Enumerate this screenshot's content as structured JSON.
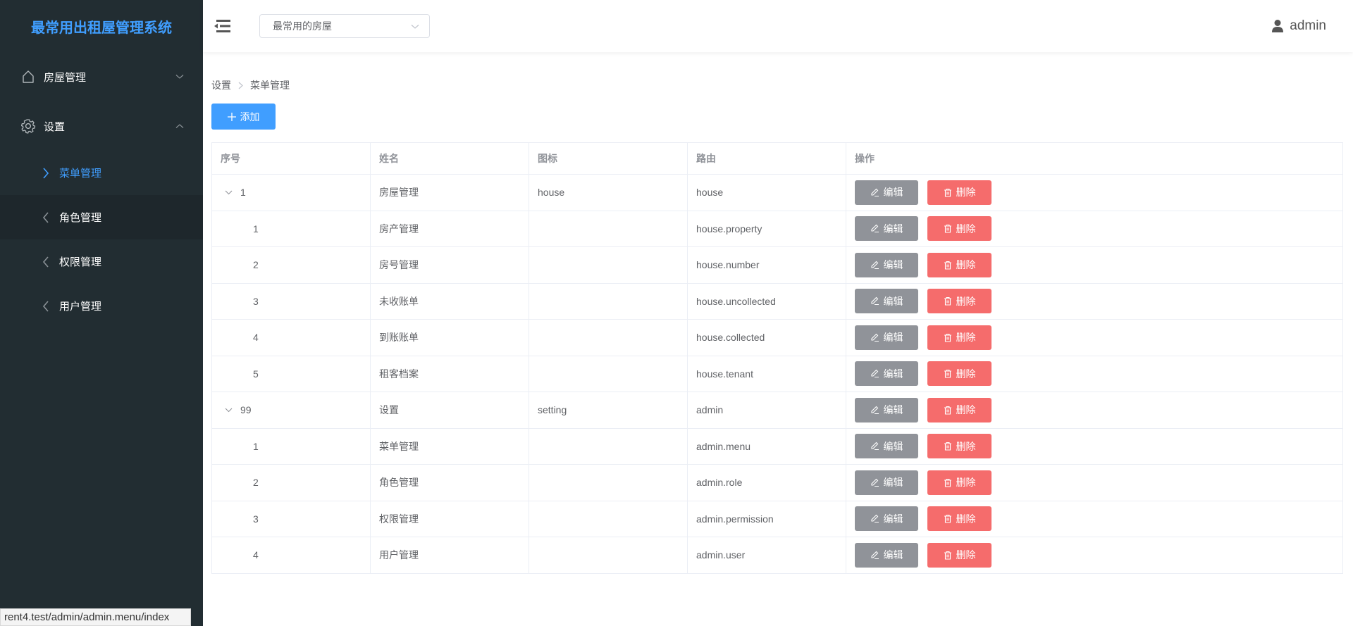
{
  "app": {
    "title": "最常用出租屋管理系统"
  },
  "sidebar": {
    "groups": [
      {
        "label": "房屋管理",
        "icon": "house-icon",
        "expanded": false
      },
      {
        "label": "设置",
        "icon": "gear-icon",
        "expanded": true
      }
    ],
    "sub_items": [
      {
        "label": "菜单管理",
        "active": true
      },
      {
        "label": "角色管理",
        "active": false
      },
      {
        "label": "权限管理",
        "active": false
      },
      {
        "label": "用户管理",
        "active": false
      }
    ]
  },
  "status_bar": {
    "url": "rent4.test/admin/admin.menu/index"
  },
  "topbar": {
    "house_select": {
      "value": "最常用的房屋"
    },
    "user": {
      "name": "admin"
    }
  },
  "breadcrumb": {
    "items": [
      "设置",
      "菜单管理"
    ]
  },
  "toolbar": {
    "add_label": "添加"
  },
  "table": {
    "columns": [
      "序号",
      "姓名",
      "图标",
      "路由",
      "操作"
    ],
    "edit_label": "编辑",
    "delete_label": "删除",
    "rows": [
      {
        "index": "1",
        "name": "房屋管理",
        "icon": "house",
        "route": "house",
        "parent": true
      },
      {
        "index": "1",
        "name": "房产管理",
        "icon": "",
        "route": "house.property",
        "parent": false
      },
      {
        "index": "2",
        "name": "房号管理",
        "icon": "",
        "route": "house.number",
        "parent": false
      },
      {
        "index": "3",
        "name": "未收账单",
        "icon": "",
        "route": "house.uncollected",
        "parent": false
      },
      {
        "index": "4",
        "name": "到账账单",
        "icon": "",
        "route": "house.collected",
        "parent": false
      },
      {
        "index": "5",
        "name": "租客档案",
        "icon": "",
        "route": "house.tenant",
        "parent": false
      },
      {
        "index": "99",
        "name": "设置",
        "icon": "setting",
        "route": "admin",
        "parent": true
      },
      {
        "index": "1",
        "name": "菜单管理",
        "icon": "",
        "route": "admin.menu",
        "parent": false
      },
      {
        "index": "2",
        "name": "角色管理",
        "icon": "",
        "route": "admin.role",
        "parent": false
      },
      {
        "index": "3",
        "name": "权限管理",
        "icon": "",
        "route": "admin.permission",
        "parent": false
      },
      {
        "index": "4",
        "name": "用户管理",
        "icon": "",
        "route": "admin.user",
        "parent": false
      }
    ]
  },
  "colors": {
    "sidebar_bg": "#222d32",
    "brand": "#409eff",
    "primary": "#409eff",
    "edit_button": "#909399",
    "delete_button": "#f56c6c"
  }
}
